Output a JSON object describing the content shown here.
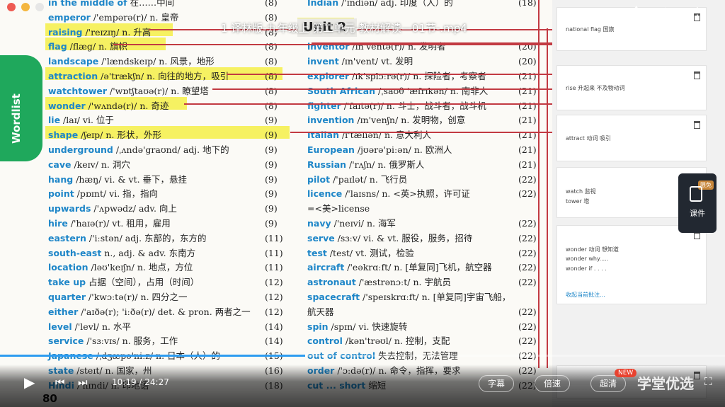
{
  "video": {
    "title": "1 译林版-九年级上 第二单元-教材解读—01节-.mp4",
    "unit_heading": "Unit 2",
    "current_time": "10:19",
    "duration": "24:27",
    "progress": 0.4213
  },
  "book": {
    "tab_label": "Wordlist",
    "page_number": "80",
    "left_entries": [
      {
        "word": "in the middle of",
        "rest": " 在……中间",
        "page": "(8)"
      },
      {
        "word": "emperor",
        "rest": " /'empərə(r)/ n. 皇帝",
        "page": "(8)"
      },
      {
        "word": "raising",
        "rest": " /'reɪzɪŋ/ n. 升高",
        "page": "(8)"
      },
      {
        "word": "flag",
        "rest": " /flæg/ n. 旗帜",
        "page": "(8)"
      },
      {
        "word": "landscape",
        "rest": " /'lændskeɪp/ n. 风景，地形",
        "page": "(8)"
      },
      {
        "word": "attraction",
        "rest": " /ə'trækʃn/ n. 向往的地方，吸引",
        "page": "(8)"
      },
      {
        "word": "watchtower",
        "rest": " /'wɒtʃtaʊə(r)/ n. 瞭望塔",
        "page": "(8)"
      },
      {
        "word": "wonder",
        "rest": " /'wʌndə(r)/ n. 奇迹",
        "page": "(8)"
      },
      {
        "word": "lie",
        "rest": " /laɪ/ vi. 位于",
        "page": "(9)"
      },
      {
        "word": "shape",
        "rest": " /ʃeɪp/ n. 形状，外形",
        "page": "(9)"
      },
      {
        "word": "underground",
        "rest": " /ˌʌndə'graʊnd/ adj. 地下的",
        "page": "(9)"
      },
      {
        "word": "cave",
        "rest": " /keɪv/ n. 洞穴",
        "page": "(9)"
      },
      {
        "word": "hang",
        "rest": " /hæŋ/ vi. & vt. 垂下，悬挂",
        "page": "(9)"
      },
      {
        "word": "point",
        "rest": " /pɒɪnt/ vi. 指，指向",
        "page": "(9)"
      },
      {
        "word": "upwards",
        "rest": " /'ʌpwədz/ adv. 向上",
        "page": "(9)"
      },
      {
        "word": "hire",
        "rest": " /'haɪə(r)/ vt. 租用，雇用",
        "page": "(9)"
      },
      {
        "word": "eastern",
        "rest": " /'iːstən/ adj. 东部的，东方的",
        "page": "(11)"
      },
      {
        "word": "south-east",
        "rest": " n., adj. & adv. 东南方",
        "page": "(11)"
      },
      {
        "word": "location",
        "rest": " /ləʊ'keɪʃn/ n. 地点，方位",
        "page": "(11)"
      },
      {
        "word": "take up",
        "rest": " 占据（空间），占用（时间）",
        "page": "(12)"
      },
      {
        "word": "quarter",
        "rest": " /'kwɔːtə(r)/ n. 四分之一",
        "page": "(12)"
      },
      {
        "word": "either",
        "rest": " /'aɪðə(r); 'iːðə(r)/ det. & pron. 两者之一",
        "page": "(12)"
      },
      {
        "word": "level",
        "rest": " /'levl/ n. 水平",
        "page": "(14)"
      },
      {
        "word": "service",
        "rest": " /'sɜːvɪs/ n. 服务，工作",
        "page": "(14)"
      },
      {
        "word": "Japanese",
        "rest": " /ˌdʒæpə'niːz/ n. 日本（人）的",
        "page": "(15)"
      },
      {
        "word": "state",
        "rest": " /steɪt/ n. 国家，州",
        "page": "(16)"
      },
      {
        "word": "Hindi",
        "rest": " /'hɪndi/ n. 印地语",
        "page": "(18)"
      }
    ],
    "right_entries": [
      {
        "word": "Indian",
        "rest": " /'ɪndiən/ adj. 印度（人）的",
        "page": "(18)"
      },
      {
        "word": "",
        "rest": "",
        "page": ""
      },
      {
        "word": "",
        "rest": "",
        "page": ""
      },
      {
        "word": "inventor",
        "rest": " /ɪn'ventə(r)/ n. 发明者",
        "page": "(20)"
      },
      {
        "word": "invent",
        "rest": " /ɪn'vent/ vt. 发明",
        "page": "(20)"
      },
      {
        "word": "explorer",
        "rest": " /ɪk'splɔːrə(r)/ n. 探险者，考察者",
        "page": "(21)"
      },
      {
        "word": "South African",
        "rest": " /ˌsaʊθ 'æfrɪkən/ n. 南非人",
        "page": "(21)"
      },
      {
        "word": "fighter",
        "rest": " /'faɪtə(r)/ n. 斗士，战斗者，战斗机",
        "page": "(21)"
      },
      {
        "word": "invention",
        "rest": " /ɪn'venʃn/ n. 发明物，创意",
        "page": "(21)"
      },
      {
        "word": "Italian",
        "rest": " /ɪ'tæliən/ n. 意大利人",
        "page": "(21)"
      },
      {
        "word": "European",
        "rest": " /jʊərə'piːən/ n. 欧洲人",
        "page": "(21)"
      },
      {
        "word": "Russian",
        "rest": " /'rʌʃn/ n. 俄罗斯人",
        "page": "(21)"
      },
      {
        "word": "pilot",
        "rest": " /'paɪlət/ n. 飞行员",
        "page": "(22)"
      },
      {
        "word": "licence",
        "rest": " /'laɪsns/ n. <英>执照，许可证",
        "page": "(22)"
      },
      {
        "word": "",
        "rest": "=<美>license",
        "page": ""
      },
      {
        "word": "navy",
        "rest": " /'neɪvi/ n. 海军",
        "page": "(22)"
      },
      {
        "word": "serve",
        "rest": " /sɜːv/ vi. & vt. 服役，服务，招待",
        "page": "(22)"
      },
      {
        "word": "test",
        "rest": " /test/ vt. 测试，检验",
        "page": "(22)"
      },
      {
        "word": "aircraft",
        "rest": " /'eəkrɑːft/ n. [单复同]飞机，航空器",
        "page": "(22)"
      },
      {
        "word": "astronaut",
        "rest": " /'æstrənɔːt/ n. 宇航员",
        "page": "(22)"
      },
      {
        "word": "spacecraft",
        "rest": " /'speɪskrɑːft/ n. [单复同]宇宙飞船，",
        "page": ""
      },
      {
        "word": "",
        "rest": "航天器",
        "page": "(22)"
      },
      {
        "word": "spin",
        "rest": " /spɪn/ vi. 快速旋转",
        "page": "(22)"
      },
      {
        "word": "control",
        "rest": " /kən'trəʊl/ n. 控制，支配",
        "page": "(22)"
      },
      {
        "word": "out of control",
        "rest": " 失去控制，无法管理",
        "page": "(22)"
      },
      {
        "word": "order",
        "rest": " /'ɔːdə(r)/ n. 命令，指挥，要求",
        "page": "(22)"
      },
      {
        "word": "cut ... short",
        "rest": " 缩短",
        "page": "(22)"
      }
    ]
  },
  "notes": [
    {
      "lines": [
        "national    flag    国旗"
      ]
    },
    {
      "lines": [
        "rise    升起来         不及物动词"
      ]
    },
    {
      "lines": [
        "attract    动词  吸引"
      ]
    },
    {
      "lines": [
        "watch  监视",
        "tower  塔"
      ]
    },
    {
      "lines": [
        "wonder    动词     想知道",
        "wonder why.....",
        "wonder  if       . . . ."
      ],
      "more": "收起当前批注..."
    },
    {
      "lines": []
    }
  ],
  "side_widget": {
    "badge": "限免",
    "label": "课件"
  },
  "toolbar_icons": [
    "share-icon",
    "download-icon",
    "more-icon"
  ],
  "controls": {
    "subtitle": "字幕",
    "speed": "倍速",
    "quality": "超清",
    "new_badge": "NEW",
    "brand": "学堂优选"
  },
  "colors": {
    "word": "#1e86c8",
    "highlight": "#f6f05a",
    "ink": "#c23a42",
    "progress": "#2d9cf0",
    "tab": "#1fa85c"
  }
}
